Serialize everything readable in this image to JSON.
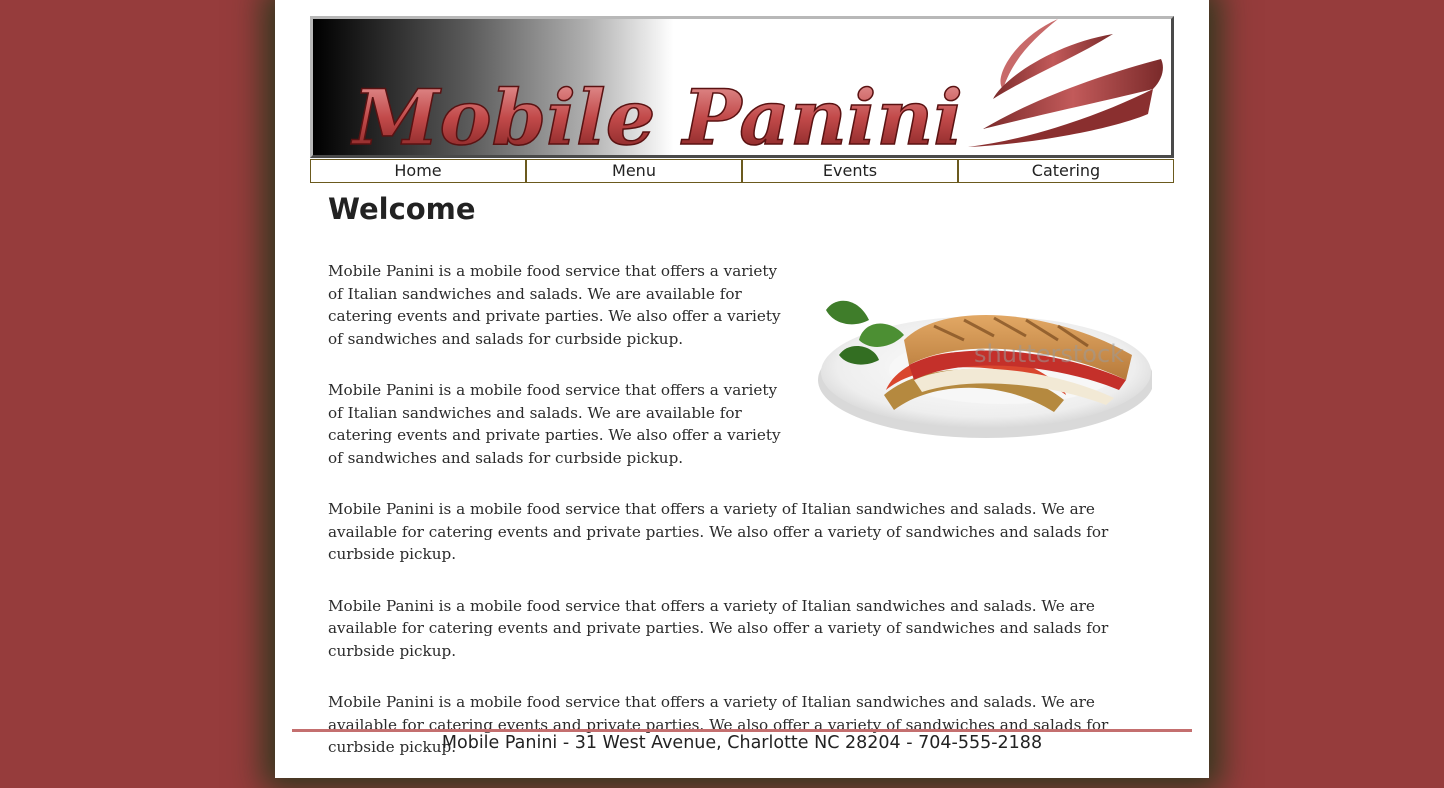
{
  "colors": {
    "background": "#963c3c",
    "accent": "#c46f6f",
    "nav_border": "#6b5a1e"
  },
  "header": {
    "logo_text": "Mobile Panini"
  },
  "nav": {
    "items": [
      {
        "label": "Home"
      },
      {
        "label": "Menu"
      },
      {
        "label": "Events"
      },
      {
        "label": "Catering"
      }
    ]
  },
  "main": {
    "title": "Welcome",
    "photo": {
      "icon": "panini-sandwich-photo",
      "watermark": "shutterstock"
    },
    "paragraphs": [
      "Mobile Panini is a mobile food service that offers a variety of Italian sandwiches and salads. We are available for catering events and private parties. We also offer a variety of sandwiches and salads for curbside pickup.",
      "Mobile Panini is a mobile food service that offers a variety of Italian sandwiches and salads. We are available for catering events and private parties. We also offer a variety of sandwiches and salads for curbside pickup.",
      "Mobile Panini is a mobile food service that offers a variety of Italian sandwiches and salads. We are available for catering events and private parties. We also offer a variety of sandwiches and salads for curbside pickup.",
      "Mobile Panini is a mobile food service that offers a variety of Italian sandwiches and salads. We are available for catering events and private parties. We also offer a variety of sandwiches and salads for curbside pickup.",
      "Mobile Panini is a mobile food service that offers a variety of Italian sandwiches and salads. We are available for catering events and private parties. We also offer a variety of sandwiches and salads for curbside pickup."
    ]
  },
  "footer": {
    "text": "Mobile Panini - 31 West Avenue, Charlotte NC 28204 - 704-555-2188"
  }
}
